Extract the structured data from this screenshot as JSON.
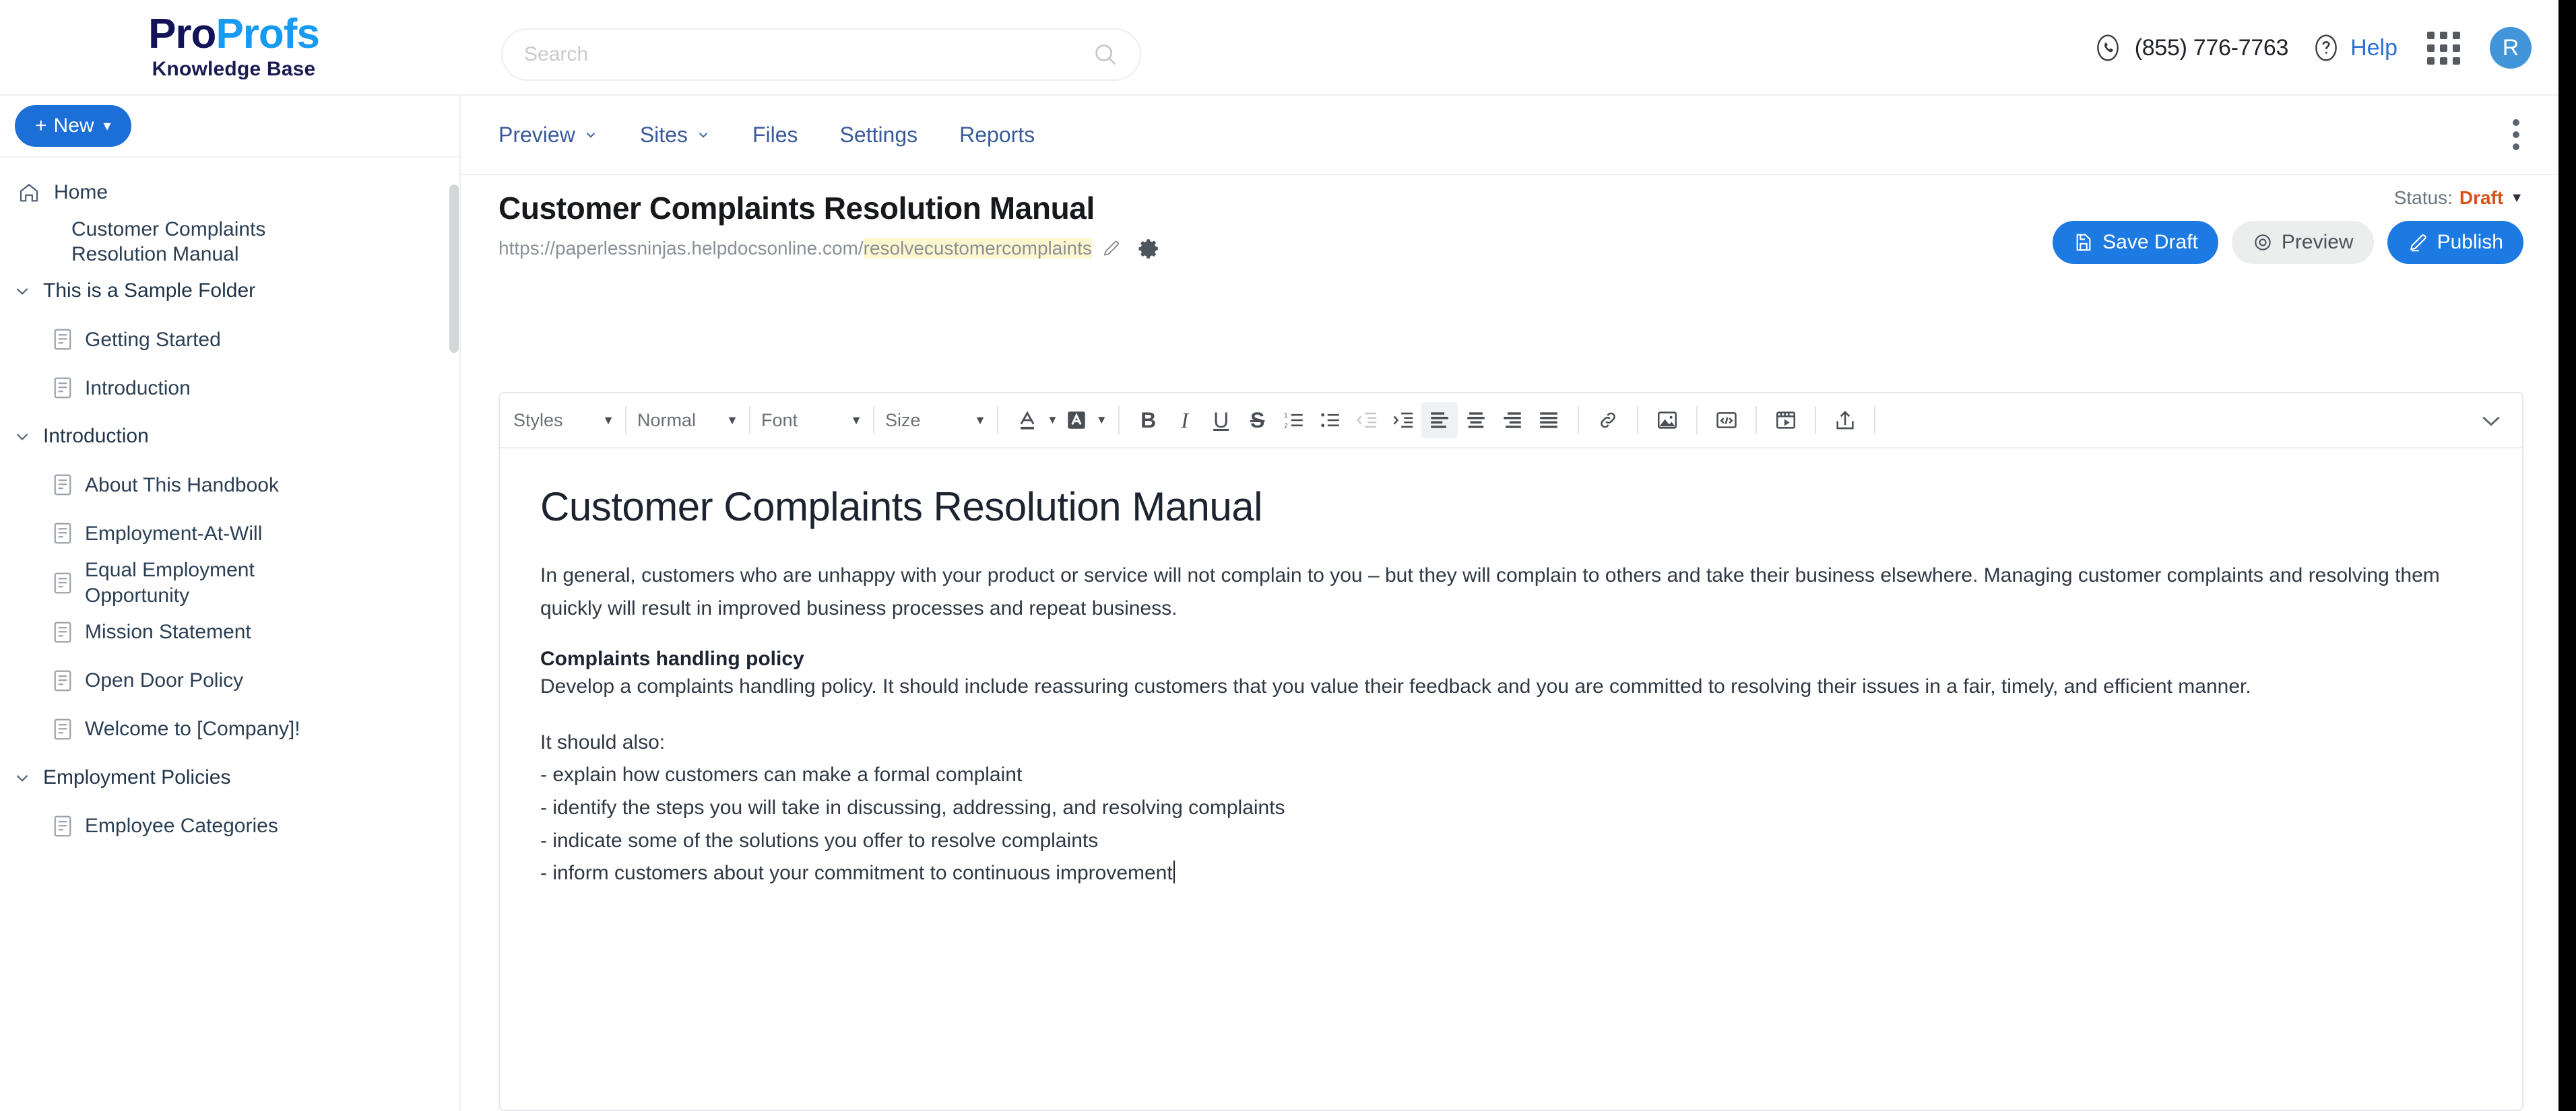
{
  "brand": {
    "logo_pro": "Pro",
    "logo_profs": "Profs",
    "logo_sub": "Knowledge Base",
    "accent_blue": "#1c7ae2",
    "logo_navy": "#121259",
    "logo_cyan": "#169bf0"
  },
  "search": {
    "placeholder": "Search",
    "value": "",
    "icon": "search-icon"
  },
  "topbar": {
    "phone_icon": "phone-circle-icon",
    "phone": "(855) 776-7763",
    "help_icon": "question-circle-icon",
    "help_label": "Help",
    "apps_icon": "apps-grid-icon",
    "avatar_initial": "R"
  },
  "sidebar": {
    "new_button": {
      "label": "New",
      "plus": "+",
      "caret_icon": "chevron-down-icon"
    },
    "items": [
      {
        "label": "Home",
        "type": "home",
        "icon": "home-icon"
      },
      {
        "label": "Customer Complaints Resolution Manual",
        "type": "doc-top",
        "icon": ""
      },
      {
        "label": "This is a Sample Folder",
        "type": "folder",
        "icon": "chevron-down-icon"
      },
      {
        "label": "Getting Started",
        "type": "page",
        "icon": "document-icon"
      },
      {
        "label": "Introduction",
        "type": "page",
        "icon": "document-icon"
      },
      {
        "label": "Introduction",
        "type": "folder",
        "icon": "chevron-down-icon"
      },
      {
        "label": "About This Handbook",
        "type": "page",
        "icon": "document-icon"
      },
      {
        "label": "Employment-At-Will",
        "type": "page",
        "icon": "document-icon"
      },
      {
        "label": "Equal Employment Opportunity",
        "type": "page",
        "icon": "document-icon"
      },
      {
        "label": "Mission Statement",
        "type": "page",
        "icon": "document-icon"
      },
      {
        "label": "Open Door Policy",
        "type": "page",
        "icon": "document-icon"
      },
      {
        "label": "Welcome to [Company]!",
        "type": "page",
        "icon": "document-icon"
      },
      {
        "label": "Employment Policies",
        "type": "folder",
        "icon": "chevron-down-icon"
      },
      {
        "label": "Employee Categories",
        "type": "page",
        "icon": "document-icon"
      }
    ]
  },
  "nav": {
    "tabs": [
      {
        "label": "Preview",
        "has_caret": true
      },
      {
        "label": "Sites",
        "has_caret": true
      },
      {
        "label": "Files",
        "has_caret": false
      },
      {
        "label": "Settings",
        "has_caret": false
      },
      {
        "label": "Reports",
        "has_caret": false
      }
    ],
    "kebab_icon": "more-vertical-icon"
  },
  "document": {
    "title": "Customer Complaints Resolution Manual",
    "url_base": "https://paperlessninjas.helpdocsonline.com/",
    "url_slug": "resolvecustomercomplaints",
    "edit_icon": "pencil-icon",
    "settings_icon": "gear-icon",
    "status_label": "Status:",
    "status_value": "Draft",
    "status_caret_icon": "caret-down-icon",
    "buttons": [
      {
        "label": "Save Draft",
        "icon": "save-file-icon",
        "style": "primary"
      },
      {
        "label": "Preview",
        "icon": "eye-icon",
        "style": "ghost"
      },
      {
        "label": "Publish",
        "icon": "publish-pencil-icon",
        "style": "primary"
      }
    ]
  },
  "toolbar": {
    "selects": [
      {
        "label": "Styles",
        "caret_icon": "caret-down-icon"
      },
      {
        "label": "Normal",
        "caret_icon": "caret-down-icon"
      },
      {
        "label": "Font",
        "caret_icon": "caret-down-icon"
      },
      {
        "label": "Size",
        "caret_icon": "caret-down-icon"
      }
    ],
    "buttons": [
      {
        "name": "text-color-icon",
        "state": "normal"
      },
      {
        "name": "background-color-icon",
        "state": "normal"
      },
      {
        "name": "bold-icon",
        "state": "normal"
      },
      {
        "name": "italic-icon",
        "state": "normal"
      },
      {
        "name": "underline-icon",
        "state": "normal"
      },
      {
        "name": "strikethrough-icon",
        "state": "normal"
      },
      {
        "name": "numbered-list-icon",
        "state": "normal"
      },
      {
        "name": "bulleted-list-icon",
        "state": "normal"
      },
      {
        "name": "outdent-icon",
        "state": "disabled"
      },
      {
        "name": "indent-icon",
        "state": "normal"
      },
      {
        "name": "align-left-icon",
        "state": "active"
      },
      {
        "name": "align-center-icon",
        "state": "normal"
      },
      {
        "name": "align-right-icon",
        "state": "normal"
      },
      {
        "name": "align-justify-icon",
        "state": "normal"
      },
      {
        "name": "link-icon",
        "state": "normal"
      },
      {
        "name": "image-icon",
        "state": "normal"
      },
      {
        "name": "source-code-icon",
        "state": "normal"
      },
      {
        "name": "video-icon",
        "state": "normal"
      },
      {
        "name": "upload-icon",
        "state": "normal"
      }
    ],
    "expand_icon": "chevron-down-icon"
  },
  "content": {
    "heading": "Customer Complaints Resolution Manual",
    "paragraph_1": "In general, customers who are unhappy with your product or service will not complain to you – but they will complain to others and take their business elsewhere. Managing customer complaints and resolving them quickly will result in improved business processes and repeat business.",
    "subheading": "Complaints handling policy",
    "paragraph_2": "Develop a complaints handling policy. It should include reassuring customers that you value their feedback and you are committed to resolving their issues in a fair, timely, and efficient manner.",
    "list_intro": "It should also:",
    "list_items": [
      "- explain how customers can make a formal complaint",
      "- identify the steps you will take in discussing, addressing, and resolving complaints",
      "- indicate some of the solutions you offer to resolve complaints",
      "- inform customers about your commitment to continuous improvement"
    ]
  }
}
